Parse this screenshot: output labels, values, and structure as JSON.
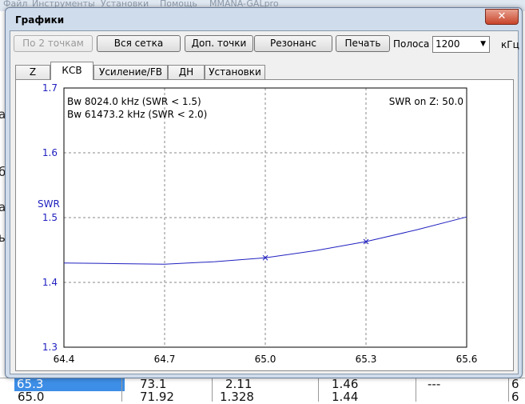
{
  "background": {
    "menu": [
      "Файл",
      "Инструменты",
      "Установки",
      "Помощь",
      "MMANA-GALpro"
    ],
    "left_letters": [
      "а",
      "б",
      "а",
      "ы"
    ],
    "table_rows": [
      [
        "65.3",
        "73.1",
        "2.11",
        "1.46",
        "---",
        "6"
      ],
      [
        "65.0",
        "71.92",
        "1.328",
        "1.44",
        "",
        "6"
      ]
    ]
  },
  "dialog": {
    "title": "Графики",
    "close_label": "✕"
  },
  "toolbar": {
    "btn_2pts": "По 2 точкам",
    "btn_grid": "Вся сетка",
    "btn_extra": "Доп. точки",
    "btn_resonance": "Резонанс",
    "btn_print": "Печать",
    "band_label": "Полоса",
    "band_value": "1200",
    "band_unit": "кГц"
  },
  "tabs": [
    "Z",
    "КСВ",
    "Усиление/FB",
    "ДН",
    "Установки"
  ],
  "active_tab": 1,
  "chart_data": {
    "type": "line",
    "ylabel": "SWR",
    "xlim": [
      64.4,
      65.6
    ],
    "ylim": [
      1.3,
      1.7
    ],
    "x_ticks": [
      "64.4",
      "64.7",
      "65.0",
      "65.3",
      "65.6"
    ],
    "y_ticks": [
      "1.3",
      "1.4",
      "1.5",
      "1.6",
      "1.7"
    ],
    "grid": true,
    "annotations": {
      "bw1": "Bw 8024.0 kHz (SWR < 1.5)",
      "bw2": "Bw 61473.2 kHz (SWR < 2.0)",
      "swr_on_z": "SWR on Z: 50.0"
    },
    "series": [
      {
        "x": [
          64.4,
          64.55,
          64.7,
          64.85,
          65.0,
          65.15,
          65.3,
          65.45,
          65.6
        ],
        "y": [
          1.43,
          1.429,
          1.428,
          1.432,
          1.438,
          1.449,
          1.463,
          1.481,
          1.501
        ],
        "color": "#2020c0"
      }
    ],
    "markers": {
      "x": [
        65.0,
        65.3
      ],
      "y": [
        1.438,
        1.463
      ]
    }
  }
}
